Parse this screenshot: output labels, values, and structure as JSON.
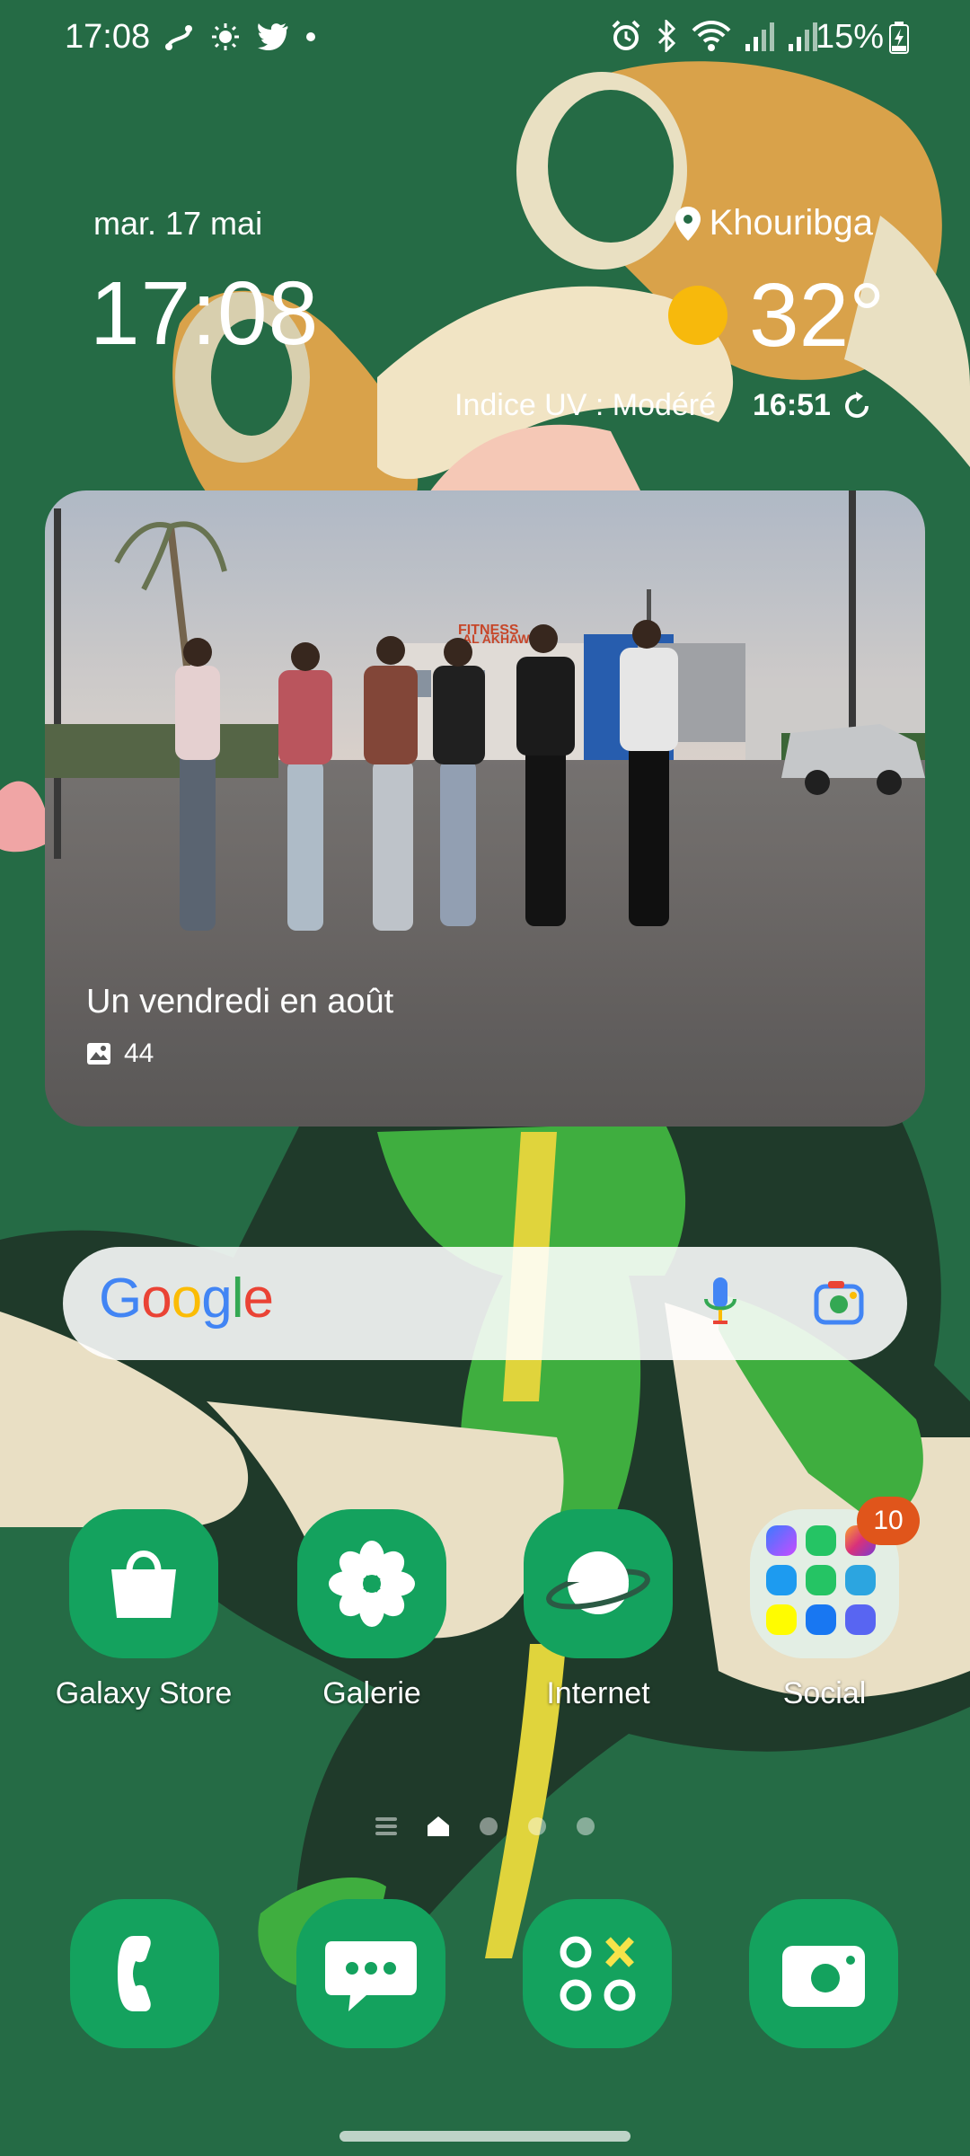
{
  "status_bar": {
    "time": "17:08",
    "battery": "15%"
  },
  "clock_widget": {
    "date": "mar. 17 mai",
    "time": "17:08"
  },
  "weather_widget": {
    "location": "Khouribga",
    "temperature": "32°",
    "uv_index": "Indice UV : Modéré",
    "updated_time": "16:51"
  },
  "photo_widget": {
    "caption": "Un vendredi en août",
    "count": "44",
    "sign_text_1": "FITNESS",
    "sign_text_2": "AL AKHAWIN"
  },
  "search": {
    "logo": "Google"
  },
  "apps": [
    {
      "label": "Galaxy Store"
    },
    {
      "label": "Galerie"
    },
    {
      "label": "Internet"
    },
    {
      "label": "Social"
    }
  ],
  "social_badge": "10",
  "colors": {
    "background": "#256b45",
    "app_green": "#14a25e",
    "badge": "#e0551b",
    "sun": "#f7b90c"
  }
}
